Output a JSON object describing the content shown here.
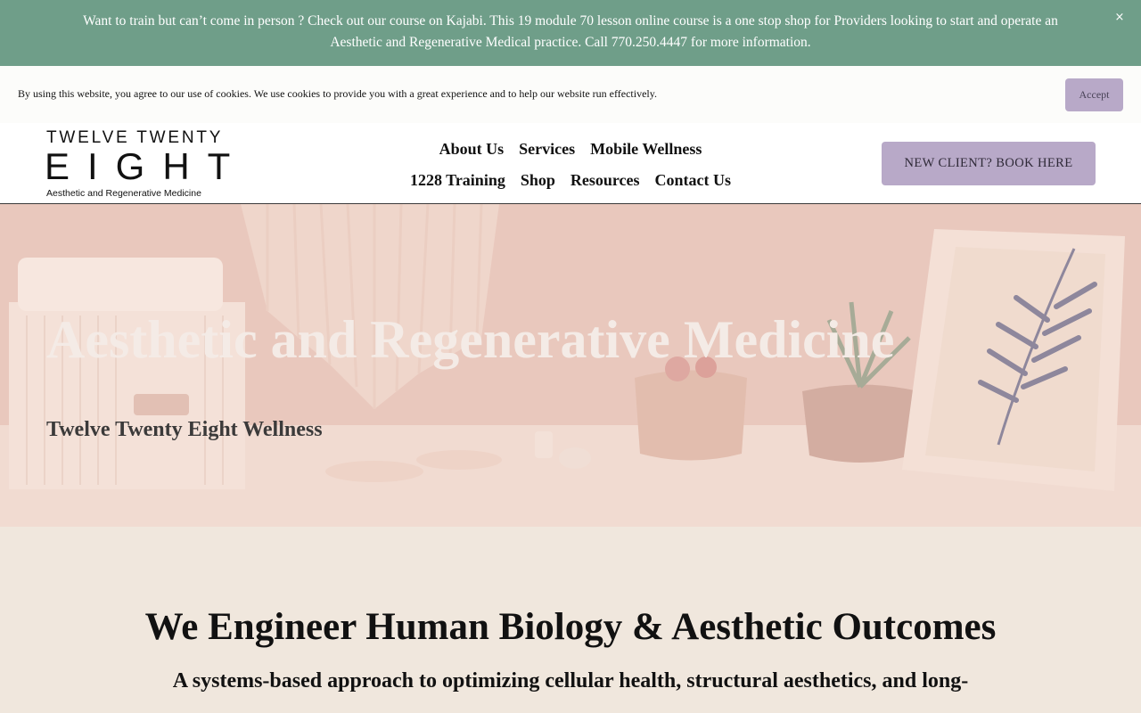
{
  "announcement": {
    "text": "Want to train but can’t come in person ? Check out our course on Kajabi. This 19 module 70 lesson online course is a one stop shop for Providers looking to start and operate an Aesthetic and Regenerative Medical practice.  Call 770.250.4447 for more information.",
    "close_label": "×"
  },
  "cookie": {
    "text": "By using this website, you agree to our use of cookies. We use cookies to provide you with a great experience and to help our website run effectively.",
    "accept_label": "Accept"
  },
  "header": {
    "logo": {
      "line1": "TWELVE TWENTY",
      "line2": "EIGHT",
      "line3": "Aesthetic and Regenerative Medicine"
    },
    "nav_row1": [
      "About Us",
      "Services",
      "Mobile Wellness"
    ],
    "nav_row2": [
      "1228 Training",
      "Shop",
      "Resources",
      "Contact Us"
    ],
    "cta_label": "NEW CLIENT? BOOK HERE"
  },
  "hero": {
    "title": "Aesthetic and Regenerative Medicine",
    "subtitle": "Twelve Twenty Eight Wellness"
  },
  "section": {
    "title": "We Engineer Human Biology & Aesthetic Outcomes",
    "subtitle": "A systems-based approach to optimizing cellular health, structural aesthetics, and long-"
  },
  "colors": {
    "announcement_bg": "#6f9e89",
    "accent_lavender": "#b8a9c8",
    "section_bg": "#f0e7dd"
  },
  "icons": {
    "announcement_close": "close-icon"
  }
}
